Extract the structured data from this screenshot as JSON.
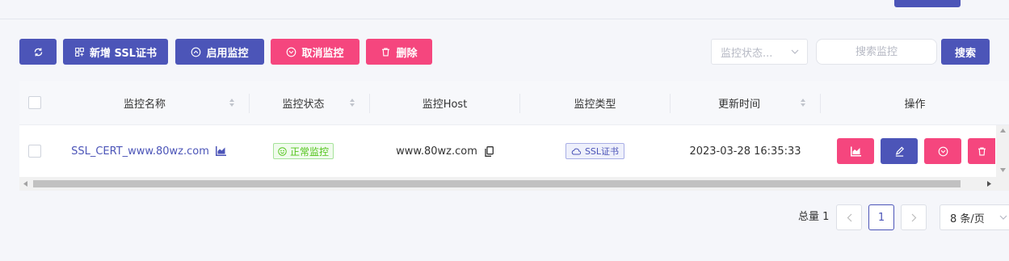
{
  "toolbar": {
    "refresh_label": "",
    "add_ssl_label": "新增 SSL证书",
    "enable_monitor_label": "启用监控",
    "cancel_monitor_label": "取消监控",
    "delete_label": "删除"
  },
  "filters": {
    "status_placeholder": "监控状态...",
    "search_placeholder": "搜索监控",
    "search_button": "搜索"
  },
  "table": {
    "columns": [
      "监控名称",
      "监控状态",
      "监控Host",
      "监控类型",
      "更新时间",
      "操作"
    ],
    "rows": [
      {
        "name": "SSL_CERT_www.80wz.com",
        "status": "正常监控",
        "host": "www.80wz.com",
        "type": "SSL证书",
        "updated": "2023-03-28 16:35:33"
      }
    ]
  },
  "pagination": {
    "total_label": "总量 1",
    "current_page": "1",
    "page_size": "8 条/页"
  },
  "colors": {
    "primary": "#4c55b8",
    "danger": "#f5467e",
    "success": "#52c41a"
  }
}
